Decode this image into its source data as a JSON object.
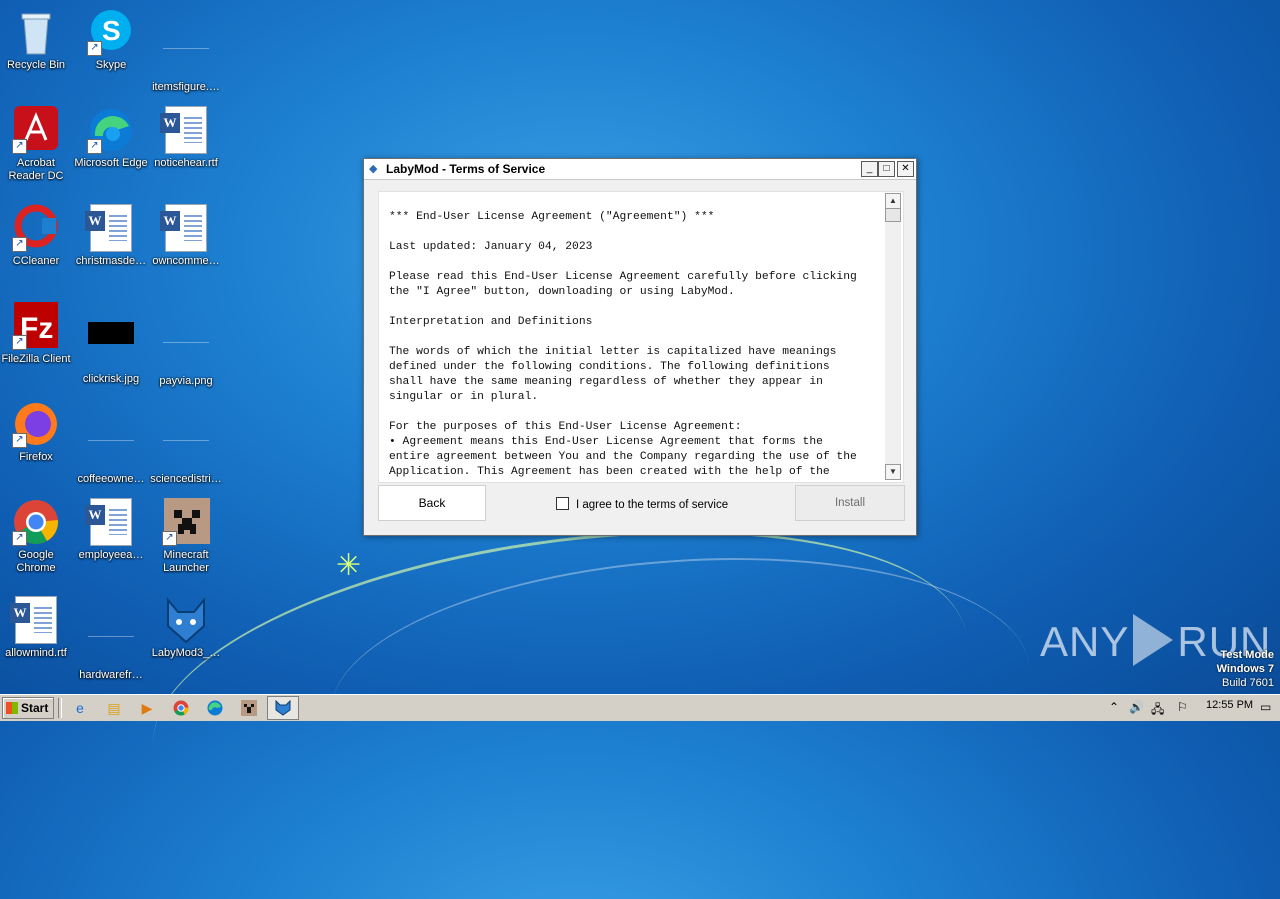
{
  "desktop": {
    "icons": [
      {
        "label": "Recycle Bin",
        "icon": "recycle-bin-icon"
      },
      {
        "label": "Skype",
        "icon": "skype-icon"
      },
      {
        "label": "itemsfigure.…",
        "icon": "blank-file-icon"
      },
      {
        "label": "Acrobat Reader DC",
        "icon": "acrobat-icon"
      },
      {
        "label": "Microsoft Edge",
        "icon": "edge-icon"
      },
      {
        "label": "noticehear.rtf",
        "icon": "word-doc-icon"
      },
      {
        "label": "CCleaner",
        "icon": "ccleaner-icon"
      },
      {
        "label": "christmasde…",
        "icon": "word-doc-icon"
      },
      {
        "label": "owncomme…",
        "icon": "word-doc-icon"
      },
      {
        "label": "FileZilla Client",
        "icon": "filezilla-icon"
      },
      {
        "label": "clickrisk.jpg",
        "icon": "image-file-icon"
      },
      {
        "label": "payvia.png",
        "icon": "blank-file-icon"
      },
      {
        "label": "Firefox",
        "icon": "firefox-icon"
      },
      {
        "label": "coffeeowne…",
        "icon": "blank-file-icon"
      },
      {
        "label": "sciencedistri…",
        "icon": "blank-file-icon"
      },
      {
        "label": "Google Chrome",
        "icon": "chrome-icon"
      },
      {
        "label": "employeea…",
        "icon": "word-doc-icon"
      },
      {
        "label": "Minecraft Launcher",
        "icon": "minecraft-icon"
      },
      {
        "label": "allowmind.rtf",
        "icon": "word-doc-icon"
      },
      {
        "label": "hardwarefr…",
        "icon": "blank-file-icon"
      },
      {
        "label": "LabyMod3_…",
        "icon": "labymod-icon"
      }
    ]
  },
  "window": {
    "title": "LabyMod - Terms of Service",
    "license_text": "*** End-User License Agreement (\"Agreement\") ***\n\nLast updated: January 04, 2023\n\nPlease read this End-User License Agreement carefully before clicking\nthe \"I Agree\" button, downloading or using LabyMod.\n\nInterpretation and Definitions\n\nThe words of which the initial letter is capitalized have meanings\ndefined under the following conditions. The following definitions\nshall have the same meaning regardless of whether they appear in\nsingular or in plural.\n\nFor the purposes of this End-User License Agreement:\n• Agreement means this End-User License Agreement that forms the\nentire agreement between You and the Company regarding the use of the\nApplication. This Agreement has been created with the help of the",
    "back_label": "Back",
    "agree_label": "I agree to the terms of service",
    "agree_checked": false,
    "install_label": "Install"
  },
  "watermark": {
    "brand_left": "ANY",
    "brand_right": "RUN",
    "line1": "Test Mode",
    "line2": "Windows 7",
    "line3": "Build 7601"
  },
  "taskbar": {
    "start_label": "Start",
    "clock": "12:55 PM",
    "pinned": [
      "internet-explorer-icon",
      "explorer-icon",
      "media-player-icon",
      "chrome-icon",
      "edge-icon",
      "minecraft-icon",
      "labymod-icon"
    ]
  }
}
